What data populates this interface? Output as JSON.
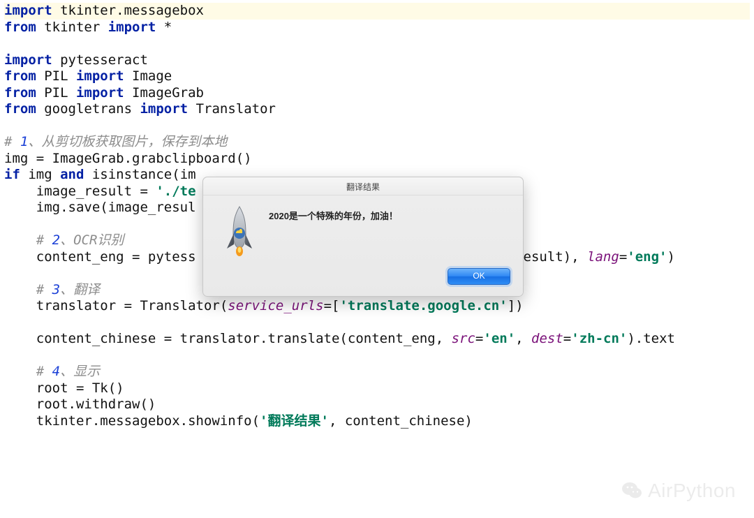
{
  "code": {
    "lines": [
      {
        "hl": true,
        "tokens": [
          {
            "c": "kw",
            "t": "import"
          },
          {
            "c": "pln",
            "t": " tkinter.messagebox"
          }
        ]
      },
      {
        "tokens": [
          {
            "c": "kw",
            "t": "from"
          },
          {
            "c": "pln",
            "t": " tkinter "
          },
          {
            "c": "kw",
            "t": "import"
          },
          {
            "c": "pln",
            "t": " *"
          }
        ]
      },
      {
        "tokens": []
      },
      {
        "tokens": [
          {
            "c": "kw",
            "t": "import"
          },
          {
            "c": "pln",
            "t": " pytesseract"
          }
        ]
      },
      {
        "tokens": [
          {
            "c": "kw",
            "t": "from"
          },
          {
            "c": "pln",
            "t": " PIL "
          },
          {
            "c": "kw",
            "t": "import"
          },
          {
            "c": "pln",
            "t": " Image"
          }
        ]
      },
      {
        "tokens": [
          {
            "c": "kw",
            "t": "from"
          },
          {
            "c": "pln",
            "t": " PIL "
          },
          {
            "c": "kw",
            "t": "import"
          },
          {
            "c": "pln",
            "t": " ImageGrab"
          }
        ]
      },
      {
        "tokens": [
          {
            "c": "kw",
            "t": "from"
          },
          {
            "c": "pln",
            "t": " googletrans "
          },
          {
            "c": "kw",
            "t": "import"
          },
          {
            "c": "pln",
            "t": " Translator"
          }
        ]
      },
      {
        "tokens": []
      },
      {
        "tokens": [
          {
            "c": "cm",
            "t": "# "
          },
          {
            "c": "cmn",
            "t": "1"
          },
          {
            "c": "cm",
            "t": "、从剪切板获取图片，保存到本地"
          }
        ]
      },
      {
        "tokens": [
          {
            "c": "pln",
            "t": "img = ImageGrab.grabclipboard()"
          }
        ]
      },
      {
        "tokens": [
          {
            "c": "kw",
            "t": "if"
          },
          {
            "c": "pln",
            "t": " img "
          },
          {
            "c": "kw",
            "t": "and"
          },
          {
            "c": "pln",
            "t": " isinstance(im"
          }
        ]
      },
      {
        "tokens": [
          {
            "c": "pln",
            "t": "    image_result = "
          },
          {
            "c": "str",
            "t": "'./te"
          }
        ]
      },
      {
        "tokens": [
          {
            "c": "pln",
            "t": "    img.save(image_resul"
          }
        ]
      },
      {
        "tokens": []
      },
      {
        "tokens": [
          {
            "c": "pln",
            "t": "    "
          },
          {
            "c": "cm",
            "t": "# "
          },
          {
            "c": "cmn",
            "t": "2"
          },
          {
            "c": "cm",
            "t": "、OCR识别"
          }
        ]
      },
      {
        "tokens": [
          {
            "c": "pln",
            "t": "    content_eng = pytess                                       _result), "
          },
          {
            "c": "kwarg",
            "t": "lang"
          },
          {
            "c": "pln",
            "t": "="
          },
          {
            "c": "str",
            "t": "'eng'"
          },
          {
            "c": "pln",
            "t": ")"
          }
        ]
      },
      {
        "tokens": []
      },
      {
        "tokens": [
          {
            "c": "pln",
            "t": "    "
          },
          {
            "c": "cm",
            "t": "# "
          },
          {
            "c": "cmn",
            "t": "3"
          },
          {
            "c": "cm",
            "t": "、翻译"
          }
        ]
      },
      {
        "tokens": [
          {
            "c": "pln",
            "t": "    translator = Translator("
          },
          {
            "c": "kwarg",
            "t": "service_urls"
          },
          {
            "c": "pln",
            "t": "=["
          },
          {
            "c": "str",
            "t": "'translate.google.cn'"
          },
          {
            "c": "pln",
            "t": "])"
          }
        ]
      },
      {
        "tokens": []
      },
      {
        "tokens": [
          {
            "c": "pln",
            "t": "    content_chinese = translator.translate(content_eng, "
          },
          {
            "c": "kwarg",
            "t": "src"
          },
          {
            "c": "pln",
            "t": "="
          },
          {
            "c": "str",
            "t": "'en'"
          },
          {
            "c": "pln",
            "t": ", "
          },
          {
            "c": "kwarg",
            "t": "dest"
          },
          {
            "c": "pln",
            "t": "="
          },
          {
            "c": "str",
            "t": "'zh-cn'"
          },
          {
            "c": "pln",
            "t": ").text"
          }
        ]
      },
      {
        "tokens": []
      },
      {
        "tokens": [
          {
            "c": "pln",
            "t": "    "
          },
          {
            "c": "cm",
            "t": "# "
          },
          {
            "c": "cmn",
            "t": "4"
          },
          {
            "c": "cm",
            "t": "、显示"
          }
        ]
      },
      {
        "tokens": [
          {
            "c": "pln",
            "t": "    root = Tk()"
          }
        ]
      },
      {
        "tokens": [
          {
            "c": "pln",
            "t": "    root.withdraw()"
          }
        ]
      },
      {
        "tokens": [
          {
            "c": "pln",
            "t": "    tkinter.messagebox.showinfo("
          },
          {
            "c": "str",
            "t": "'翻译结果'"
          },
          {
            "c": "pln",
            "t": ", content_chinese)"
          }
        ]
      }
    ]
  },
  "dialog": {
    "title": "翻译结果",
    "message": "2020是一个特殊的年份，加油！",
    "ok_label": "OK"
  },
  "watermark": {
    "text": "AirPython"
  }
}
